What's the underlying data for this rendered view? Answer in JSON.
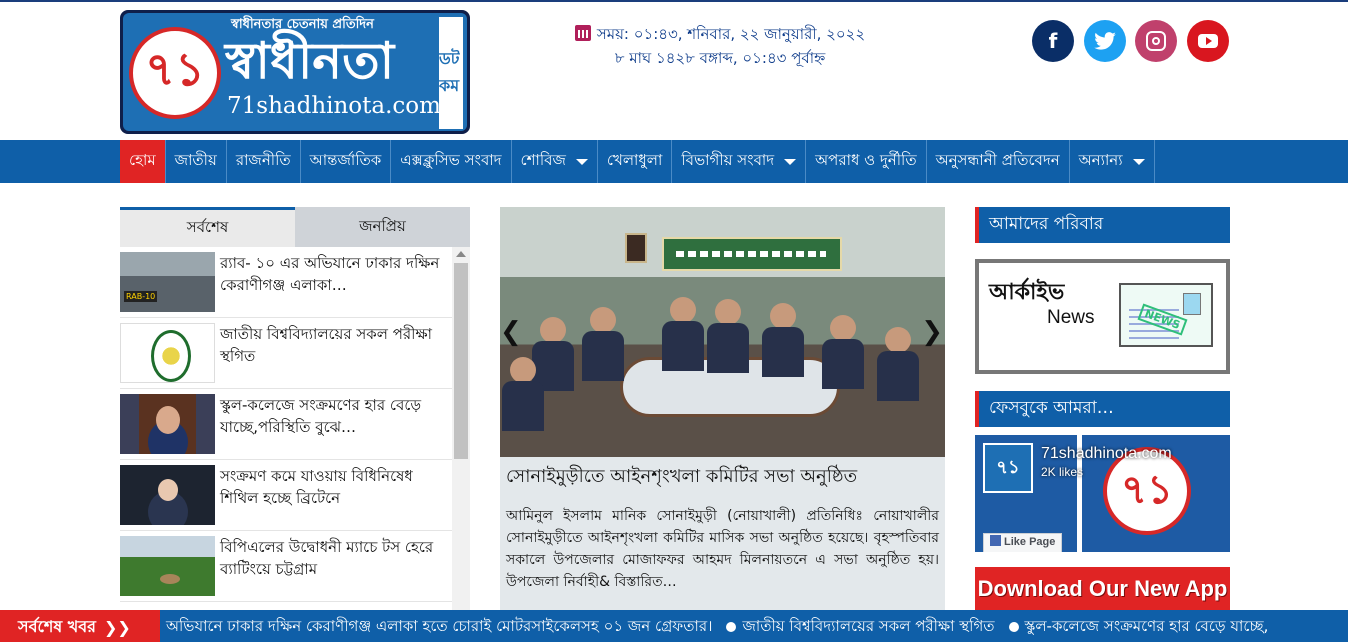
{
  "header": {
    "logo": {
      "tagline": "স্বাধীনতার চেতনায় প্রতিদিন",
      "numeral": "৭১",
      "name": "স্বাধীনতা",
      "domain": "71shadhinota.com",
      "side_text": "ডট কম"
    },
    "datetime": {
      "line1": "সময়: ০১:৪৩, শনিবার, ২২ জানুয়ারী, ২০২২",
      "line2": "৮ মাঘ ১৪২৮ বঙ্গাব্দ, ০১:৪৩ পূর্বাহ্ন"
    },
    "social": {
      "facebook": "f",
      "twitter": "🐦"
    }
  },
  "nav": {
    "items": [
      {
        "label": "হোম"
      },
      {
        "label": "জাতীয়"
      },
      {
        "label": "রাজনীতি"
      },
      {
        "label": "আন্তর্জাতিক"
      },
      {
        "label": "এক্সক্লুসিভ সংবাদ"
      },
      {
        "label": "শোবিজ"
      },
      {
        "label": "খেলাধুলা"
      },
      {
        "label": "বিভাগীয় সংবাদ"
      },
      {
        "label": "অপরাধ ও দুর্নীতি"
      },
      {
        "label": "অনুসন্ধানী প্রতিবেদন"
      },
      {
        "label": "অন্যান্য"
      }
    ]
  },
  "sidebar_left": {
    "tabs": [
      "সর্বশেষ",
      "জনপ্রিয়"
    ],
    "items": [
      {
        "title": "র‍্যাব- ১০ এর অভিযানে ঢাকার দক্ষিন কেরাণীগঞ্জ এলাকা…"
      },
      {
        "title": "জাতীয় বিশ্ববিদ্যালয়ের সকল পরীক্ষা স্থগিত"
      },
      {
        "title": "স্কুল-কলেজে সংক্রমণের হার বেড়ে যাচ্ছে,পরিস্থিতি বুঝে…"
      },
      {
        "title": "সংক্রমণ কমে যাওয়ায় বিধিনিষেধ শিথিল হচ্ছে ব্রিটেনে"
      },
      {
        "title": "বিপিএলের উদ্বোধনী ম্যাচে টস হেরে ব্যাটিংয়ে চট্টগ্রাম"
      }
    ]
  },
  "slider": {
    "title": "সোনাইমুড়ীতে আইনশৃংখলা কমিটির  সভা অনুষ্ঠিত",
    "excerpt": "আমিনুল ইসলাম মানিক সোনাইমুড়ী (নোয়াখালী) প্রতিনিধিঃ নোয়াখালীর সোনাইমুড়ীতে আইনশৃংখলা কমিটির মাসিক সভা অনুষ্ঠিত হয়েছে। বৃহস্পতিবার সকালে উপজেলার মোজাফফর আহমদ মিলনায়তনে এ সভা অনুষ্ঠিত হয়।উপজেলা নির্বাহী& বিস্তারিত…",
    "prev": "❮",
    "next": "❯"
  },
  "sidebar_right": {
    "family_title": "আমাদের পরিবার",
    "archive": {
      "label": "আর্কাইভ",
      "sub": "News",
      "tag": "NEWS"
    },
    "facebook_title": "ফেসবুকে আমরা…",
    "fb_page": {
      "name": "71shadhinota.com",
      "likes": "2K likes",
      "like_button": "Like Page",
      "numeral": "৭১"
    },
    "app_banner": "Download Our New App"
  },
  "ticker": {
    "label": "সর্বশেষ খবর",
    "chevron": "❯❯",
    "items": [
      "অভিযানে ঢাকার দক্ষিন কেরাণীগঞ্জ এলাকা হতে চোরাই মোটরসাইকেলসহ ০১ জন গ্রেফতার।",
      "জাতীয় বিশ্ববিদ্যালয়ের সকল পরীক্ষা স্থগিত",
      "স্কুল-কলেজে সংক্রমণের হার বেড়ে যাচ্ছে,"
    ]
  },
  "colors": {
    "brand_blue": "#0f5fa8",
    "accent_red": "#e02424",
    "date_text": "#0d3b8a"
  }
}
